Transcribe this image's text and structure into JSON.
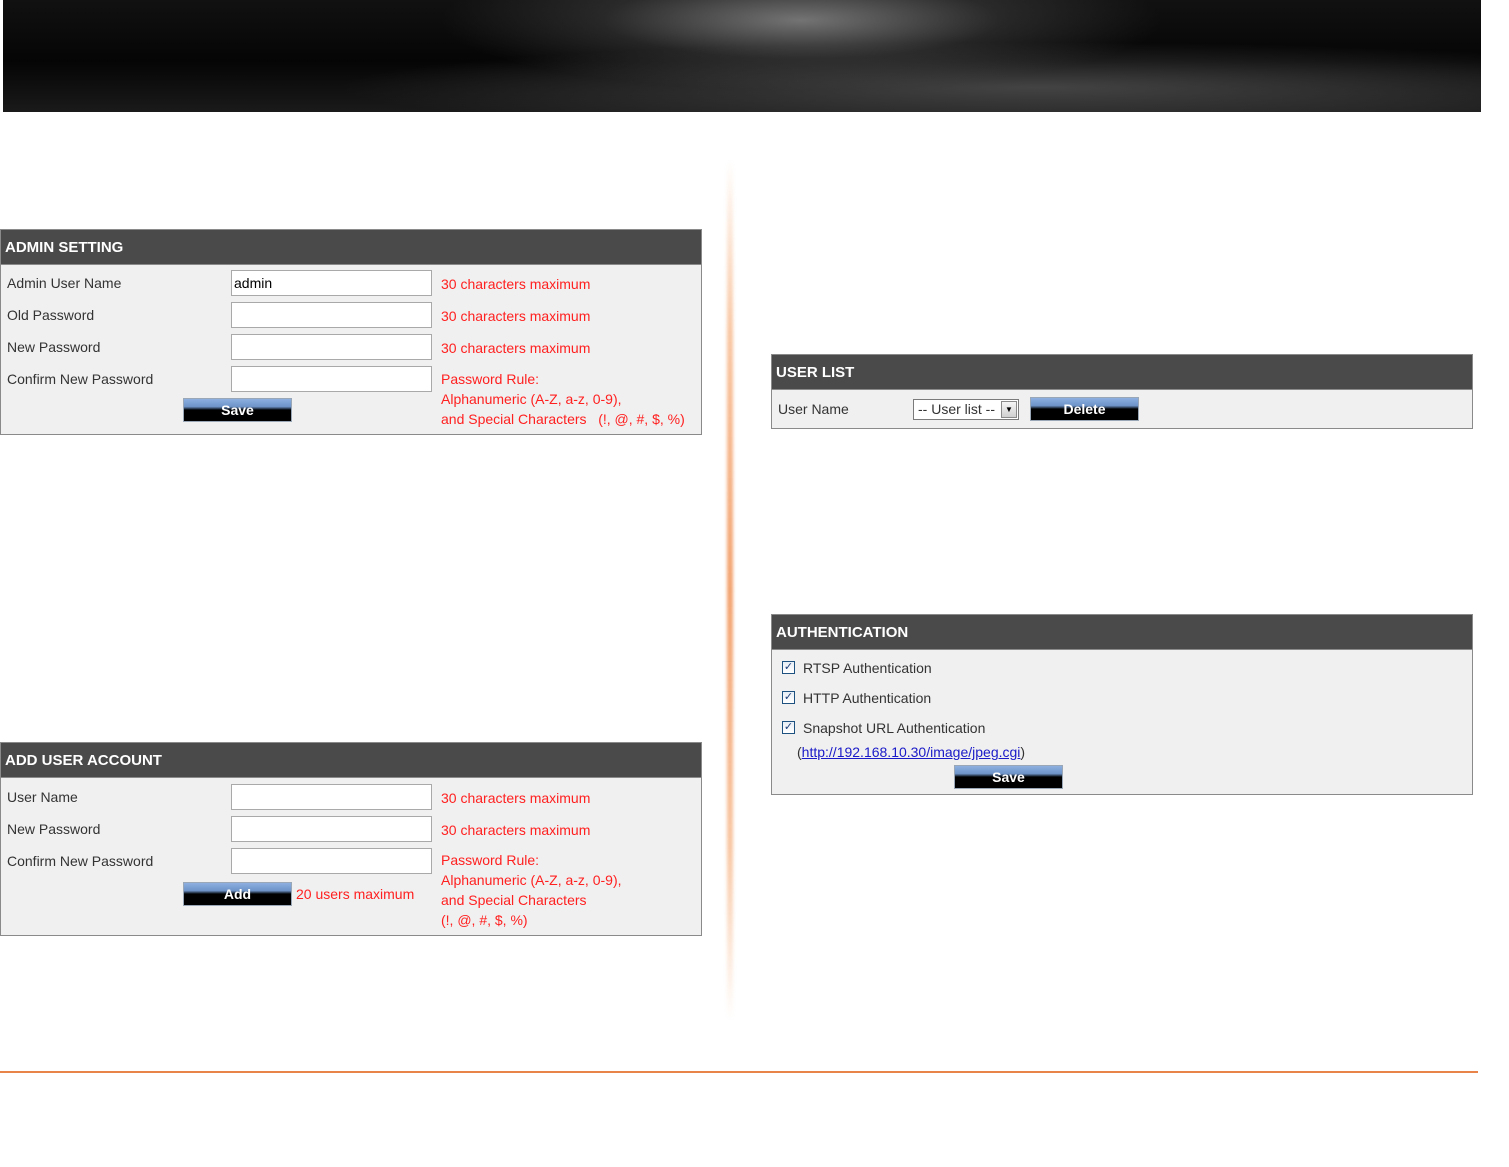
{
  "admin_setting": {
    "title": "ADMIN SETTING",
    "fields": [
      {
        "label": "Admin User Name",
        "value": "admin",
        "hint": "30 characters maximum"
      },
      {
        "label": "Old Password",
        "value": "",
        "hint": "30 characters maximum"
      },
      {
        "label": "New Password",
        "value": "",
        "hint": "30 characters maximum"
      },
      {
        "label": "Confirm New Password",
        "value": ""
      }
    ],
    "rule_lines": [
      "Password Rule:",
      "Alphanumeric (A-Z, a-z, 0-9),",
      "and Special Characters   (!, @, #, $, %)"
    ],
    "save_label": "Save"
  },
  "add_user": {
    "title": "ADD USER ACCOUNT",
    "fields": [
      {
        "label": "User Name",
        "value": "",
        "hint": "30 characters maximum"
      },
      {
        "label": "New Password",
        "value": "",
        "hint": "30 characters maximum"
      },
      {
        "label": "Confirm New Password",
        "value": ""
      }
    ],
    "rule_lines": [
      "Password Rule:",
      "Alphanumeric (A-Z, a-z, 0-9),",
      "and Special Characters",
      "(!, @, #, $, %)"
    ],
    "add_label": "Add",
    "max_users_hint": "20 users maximum"
  },
  "user_list": {
    "title": "USER LIST",
    "label": "User Name",
    "select_value": "-- User list --",
    "delete_label": "Delete"
  },
  "authentication": {
    "title": "AUTHENTICATION",
    "options": [
      {
        "label": "RTSP Authentication",
        "checked": true
      },
      {
        "label": "HTTP Authentication",
        "checked": true
      },
      {
        "label": "Snapshot URL Authentication",
        "checked": true
      }
    ],
    "url_open": "(",
    "url": "http://192.168.10.30/image/jpeg.cgi",
    "url_close": ")",
    "save_label": "Save"
  },
  "colors": {
    "panel_header": "#4a4a4a",
    "panel_body": "#f0f0f0",
    "hint_red": "#ff2020",
    "accent_orange": "#e8834a",
    "link_blue": "#1a1ac8"
  }
}
